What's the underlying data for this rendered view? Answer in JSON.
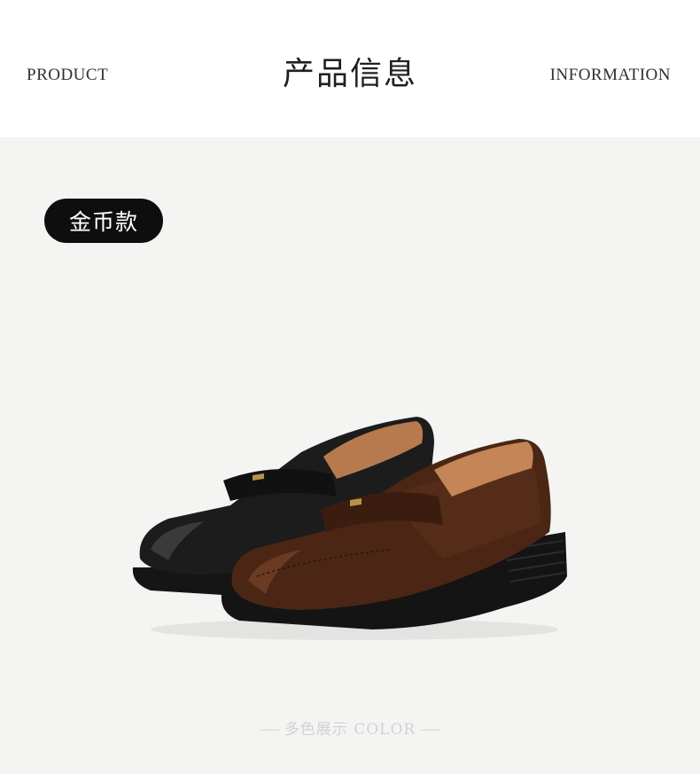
{
  "header": {
    "left_label": "PRODUCT",
    "title": "产品信息",
    "right_label": "INFORMATION"
  },
  "badge": {
    "label": "金币款"
  },
  "product_image": {
    "icon": "loafer-shoes-image",
    "colors": [
      "#1b1b1b",
      "#4a2515"
    ]
  },
  "footer": {
    "label": "多色展示 COLOR"
  }
}
